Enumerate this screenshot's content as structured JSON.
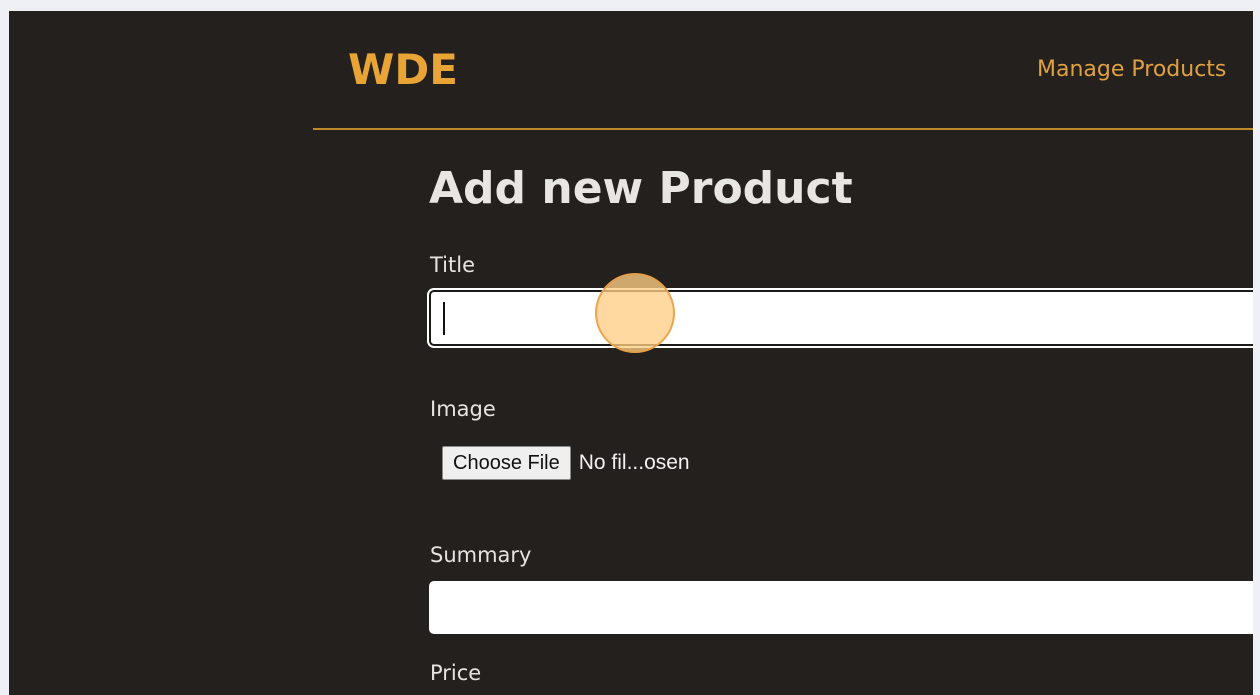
{
  "header": {
    "brand": "WDE",
    "nav_link": "Manage Products"
  },
  "form": {
    "title": "Add new Product",
    "fields": {
      "title": {
        "label": "Title",
        "value": ""
      },
      "image": {
        "label": "Image",
        "button": "Choose File",
        "status": "No fil...osen"
      },
      "summary": {
        "label": "Summary",
        "value": ""
      },
      "price": {
        "label": "Price"
      }
    }
  },
  "colors": {
    "background": "#24201e",
    "accent": "#e8a435",
    "header_rule": "#c08a2d",
    "text": "#e8e6e3"
  }
}
